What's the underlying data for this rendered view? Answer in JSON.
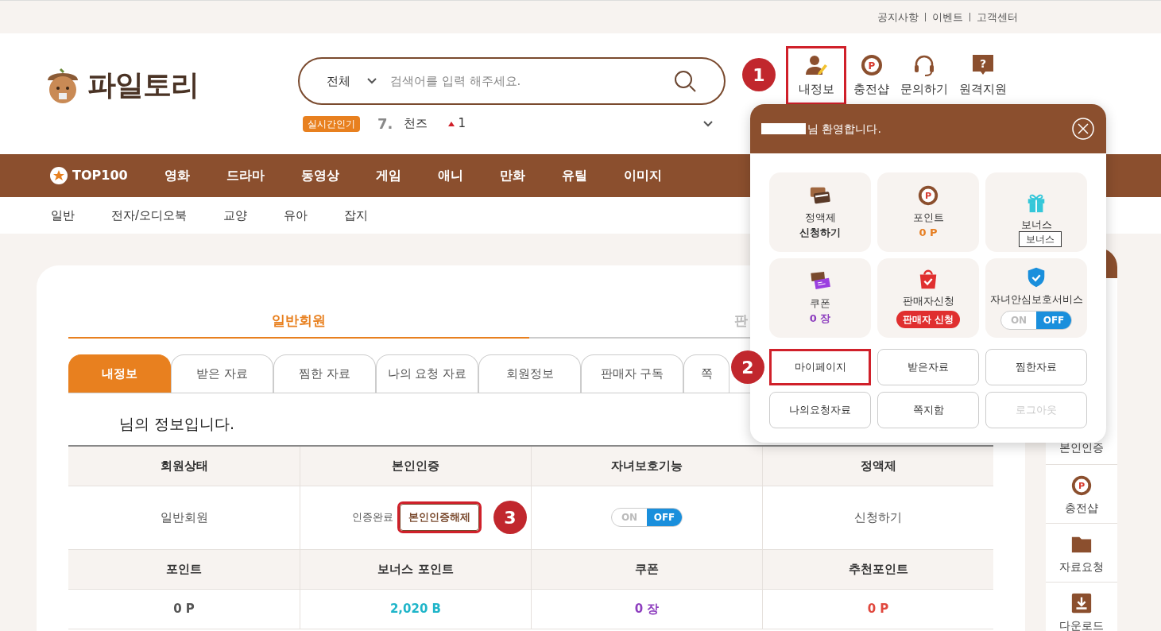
{
  "top_links": [
    "공지사항",
    "이벤트",
    "고객센터"
  ],
  "logo": {
    "text": "파일토리"
  },
  "search": {
    "category": "전체",
    "placeholder": "검색어를 입력 해주세요."
  },
  "trending": {
    "badge": "실시간인기",
    "rank": "7.",
    "keyword": "천즈",
    "change": "1"
  },
  "header_icons": [
    {
      "kind": "user",
      "label": "내정보",
      "highlighted": true,
      "annotation": "1"
    },
    {
      "kind": "point",
      "glyph": "P",
      "label": "충전샵",
      "highlighted": false
    },
    {
      "kind": "headset",
      "label": "문의하기",
      "highlighted": false
    },
    {
      "kind": "help",
      "glyph": "?",
      "label": "원격지원",
      "highlighted": false
    }
  ],
  "nav": [
    {
      "label": "TOP100",
      "kind": "star"
    },
    {
      "label": "영화",
      "kind": "plain"
    },
    {
      "label": "드라마",
      "kind": "plain"
    },
    {
      "label": "동영상",
      "kind": "plain"
    },
    {
      "label": "게임",
      "kind": "plain"
    },
    {
      "label": "애니",
      "kind": "plain"
    },
    {
      "label": "만화",
      "kind": "plain"
    },
    {
      "label": "유틸",
      "kind": "plain"
    },
    {
      "label": "이미지",
      "kind": "plain"
    }
  ],
  "subnav": [
    "일반",
    "전자/오디오북",
    "교양",
    "유아",
    "잡지"
  ],
  "member_tabs": [
    {
      "label": "일반회원",
      "selected": true
    },
    {
      "label": "판",
      "selected": false
    }
  ],
  "sub_tabs": [
    {
      "label": "내정보",
      "selected": true
    },
    {
      "label": "받은 자료",
      "selected": false
    },
    {
      "label": "찜한 자료",
      "selected": false
    },
    {
      "label": "나의 요청 자료",
      "selected": false
    },
    {
      "label": "회원정보",
      "selected": false
    },
    {
      "label": "판매자 구독",
      "selected": false
    },
    {
      "label": "쪽",
      "selected": false
    }
  ],
  "greeting": "님의 정보입니다.",
  "info_table": [
    {
      "kind": "header",
      "cells": [
        {
          "kind": "text",
          "text": "회원상태"
        },
        {
          "kind": "text",
          "text": "본인인증"
        },
        {
          "kind": "text",
          "text": "자녀보호기능"
        },
        {
          "kind": "text",
          "text": "정액제"
        }
      ]
    },
    {
      "kind": "values",
      "cells": [
        {
          "kind": "text",
          "text": "일반회원"
        },
        {
          "kind": "verify",
          "text": "인증완료",
          "button": "본인인증해제",
          "highlighted": true,
          "annotation": "3"
        },
        {
          "kind": "toggle",
          "on_label": "ON",
          "off_label": "OFF",
          "on": false
        },
        {
          "kind": "text",
          "text": "신청하기"
        }
      ]
    },
    {
      "kind": "header",
      "cells": [
        {
          "kind": "text",
          "text": "포인트"
        },
        {
          "kind": "text",
          "text": "보너스 포인트"
        },
        {
          "kind": "text",
          "text": "쿠폰"
        },
        {
          "kind": "text",
          "text": "추천포인트"
        }
      ]
    },
    {
      "kind": "values",
      "cells": [
        {
          "kind": "amount",
          "text": "0 P",
          "color": "#555555"
        },
        {
          "kind": "amount",
          "text": "2,020 B",
          "color": "#1fb5c9"
        },
        {
          "kind": "amount",
          "text": "0 장",
          "color": "#8e3fbf"
        },
        {
          "kind": "amount",
          "text": "0 P",
          "color": "#e0483e"
        }
      ]
    }
  ],
  "sidebar": [
    {
      "kind": "none",
      "label": "본인인증"
    },
    {
      "kind": "point",
      "glyph": "P",
      "label": "충전샵"
    },
    {
      "kind": "folder",
      "label": "자료요청"
    },
    {
      "kind": "download",
      "label": "다운로드"
    }
  ],
  "popup": {
    "greeting": "님 환영합니다.",
    "tiles": [
      {
        "label": "정액제",
        "kind": "value",
        "value": "신청하기",
        "color": "#333333"
      },
      {
        "glyph": "P",
        "label": "포인트",
        "kind": "value",
        "value": "0 P",
        "color": "#e67e22"
      },
      {
        "label": "보너스",
        "kind": "tooltip",
        "tooltip": "보너스"
      },
      {
        "label": "쿠폰",
        "kind": "value",
        "value": "0 장",
        "color": "#8e3fbf"
      },
      {
        "label": "판매자신청",
        "kind": "button",
        "value": "판매자 신청"
      },
      {
        "label": "자녀안심보호서비스",
        "kind": "toggle",
        "on_label": "ON",
        "off_label": "OFF",
        "on": false
      }
    ],
    "buttons": [
      {
        "label": "마이페이지",
        "highlighted": true,
        "disabled": false,
        "annotation": "2"
      },
      {
        "label": "받은자료",
        "highlighted": false,
        "disabled": false
      },
      {
        "label": "찜한자료",
        "highlighted": false,
        "disabled": false
      },
      {
        "label": "나의요청자료",
        "highlighted": false,
        "disabled": false
      },
      {
        "label": "쪽지함",
        "highlighted": false,
        "disabled": false
      },
      {
        "label": "로그아웃",
        "highlighted": false,
        "disabled": true
      }
    ]
  }
}
